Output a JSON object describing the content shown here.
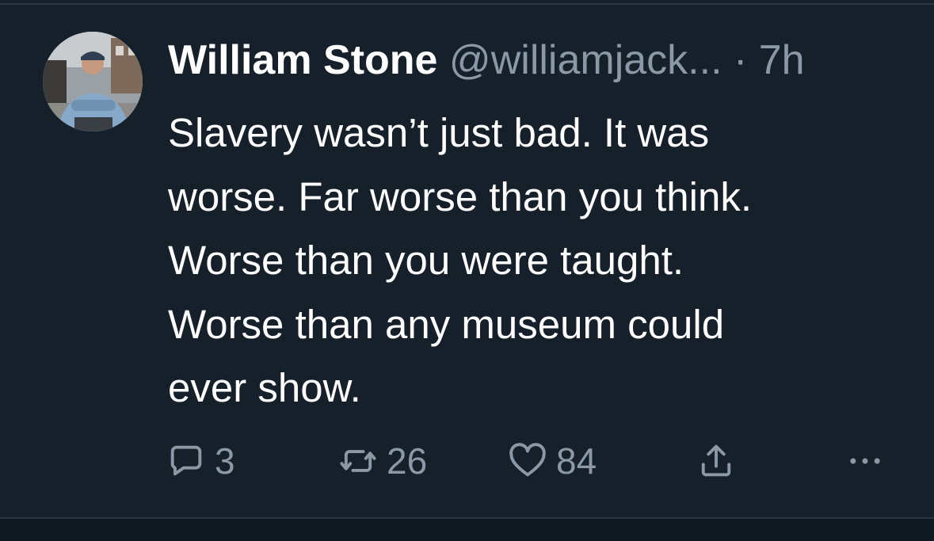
{
  "tweet": {
    "author": {
      "display_name": "William Stone",
      "handle": "@williamjack...",
      "avatar_icon": "profile-photo"
    },
    "separator": "·",
    "time": "7h",
    "text_lines": [
      "Slavery wasn’t just bad. It was",
      "worse. Far worse than you think.",
      "Worse than you were taught.",
      "Worse than any museum could",
      "ever show."
    ],
    "actions": {
      "reply": {
        "icon": "reply-icon",
        "count": "3"
      },
      "retweet": {
        "icon": "retweet-icon",
        "count": "26"
      },
      "like": {
        "icon": "heart-icon",
        "count": "84"
      },
      "share": {
        "icon": "share-icon"
      },
      "more": {
        "icon": "more-icon"
      }
    }
  },
  "colors": {
    "background": "#15202b",
    "text_primary": "#ffffff",
    "text_secondary": "#8b98a5",
    "divider": "#2b3640"
  }
}
